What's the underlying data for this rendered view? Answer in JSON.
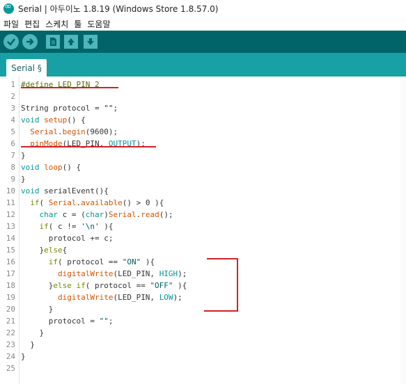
{
  "window": {
    "title": "Serial | 아두이노 1.8.19 (Windows Store 1.8.57.0)"
  },
  "menu": [
    "파일",
    "편집",
    "스케치",
    "툴",
    "도움말"
  ],
  "toolbar": {
    "buttons": [
      "verify-icon",
      "upload-icon",
      "new-icon",
      "open-icon",
      "save-icon"
    ]
  },
  "tabs": [
    {
      "label": "Serial §"
    }
  ],
  "colors": {
    "toolbar_bg": "#006468",
    "tabbar_bg": "#17a1a5",
    "button_fill": "#4db7bb",
    "annotation_red": "#d0202a"
  },
  "editor": {
    "lines": [
      {
        "n": "1",
        "tokens": [
          {
            "t": "#define LED_PIN 2",
            "c": "dir"
          }
        ]
      },
      {
        "n": "2",
        "tokens": []
      },
      {
        "n": "3",
        "tokens": [
          {
            "t": "String protocol = \"\";",
            "c": "plain"
          }
        ]
      },
      {
        "n": "4",
        "tokens": [
          {
            "t": "void",
            "c": "type"
          },
          {
            "t": " setup",
            "c": "func"
          },
          {
            "t": "() {",
            "c": "plain"
          }
        ]
      },
      {
        "n": "5",
        "tokens": [
          {
            "t": "  Serial",
            "c": "func"
          },
          {
            "t": ".",
            "c": "plain"
          },
          {
            "t": "begin",
            "c": "func"
          },
          {
            "t": "(9600);",
            "c": "plain"
          }
        ]
      },
      {
        "n": "6",
        "tokens": [
          {
            "t": "  pinMode",
            "c": "func"
          },
          {
            "t": "(LED_PIN, ",
            "c": "plain"
          },
          {
            "t": "OUTPUT",
            "c": "const"
          },
          {
            "t": ");",
            "c": "plain"
          }
        ]
      },
      {
        "n": "7",
        "tokens": [
          {
            "t": "}",
            "c": "plain"
          }
        ]
      },
      {
        "n": "8",
        "tokens": [
          {
            "t": "void",
            "c": "type"
          },
          {
            "t": " loop",
            "c": "func"
          },
          {
            "t": "() {",
            "c": "plain"
          }
        ]
      },
      {
        "n": "9",
        "tokens": [
          {
            "t": "}",
            "c": "plain"
          }
        ]
      },
      {
        "n": "10",
        "tokens": [
          {
            "t": "void",
            "c": "type"
          },
          {
            "t": " serialEvent",
            "c": "plain"
          },
          {
            "t": "(){",
            "c": "plain"
          }
        ]
      },
      {
        "n": "11",
        "tokens": [
          {
            "t": "  if",
            "c": "kw"
          },
          {
            "t": "( ",
            "c": "plain"
          },
          {
            "t": "Serial",
            "c": "func"
          },
          {
            "t": ".",
            "c": "plain"
          },
          {
            "t": "available",
            "c": "func"
          },
          {
            "t": "() > 0 ){",
            "c": "plain"
          }
        ]
      },
      {
        "n": "12",
        "tokens": [
          {
            "t": "    char",
            "c": "type"
          },
          {
            "t": " c = (",
            "c": "plain"
          },
          {
            "t": "char",
            "c": "type"
          },
          {
            "t": ")",
            "c": "plain"
          },
          {
            "t": "Serial",
            "c": "func"
          },
          {
            "t": ".",
            "c": "plain"
          },
          {
            "t": "read",
            "c": "func"
          },
          {
            "t": "();",
            "c": "plain"
          }
        ]
      },
      {
        "n": "13",
        "tokens": [
          {
            "t": "    if",
            "c": "kw"
          },
          {
            "t": "( c != ",
            "c": "plain"
          },
          {
            "t": "'\\n'",
            "c": "str"
          },
          {
            "t": " ){",
            "c": "plain"
          }
        ]
      },
      {
        "n": "14",
        "tokens": [
          {
            "t": "      protocol += c;",
            "c": "plain"
          }
        ]
      },
      {
        "n": "15",
        "tokens": [
          {
            "t": "    }",
            "c": "plain"
          },
          {
            "t": "else",
            "c": "kw"
          },
          {
            "t": "{",
            "c": "plain"
          }
        ]
      },
      {
        "n": "16",
        "tokens": [
          {
            "t": "      if",
            "c": "kw"
          },
          {
            "t": "( protocol == ",
            "c": "plain"
          },
          {
            "t": "\"ON\"",
            "c": "str"
          },
          {
            "t": " ){",
            "c": "plain"
          }
        ]
      },
      {
        "n": "17",
        "tokens": [
          {
            "t": "        digitalWrite",
            "c": "func"
          },
          {
            "t": "(LED_PIN, ",
            "c": "plain"
          },
          {
            "t": "HIGH",
            "c": "const"
          },
          {
            "t": ");",
            "c": "plain"
          }
        ]
      },
      {
        "n": "18",
        "tokens": [
          {
            "t": "      }",
            "c": "plain"
          },
          {
            "t": "else if",
            "c": "kw"
          },
          {
            "t": "( protocol == ",
            "c": "plain"
          },
          {
            "t": "\"OFF\"",
            "c": "str"
          },
          {
            "t": " ){",
            "c": "plain"
          }
        ]
      },
      {
        "n": "19",
        "tokens": [
          {
            "t": "        digitalWrite",
            "c": "func"
          },
          {
            "t": "(LED_PIN, ",
            "c": "plain"
          },
          {
            "t": "LOW",
            "c": "const"
          },
          {
            "t": ");",
            "c": "plain"
          }
        ]
      },
      {
        "n": "20",
        "tokens": [
          {
            "t": "      }",
            "c": "plain"
          }
        ]
      },
      {
        "n": "21",
        "tokens": [
          {
            "t": "      protocol = ",
            "c": "plain"
          },
          {
            "t": "\"\"",
            "c": "str"
          },
          {
            "t": ";",
            "c": "plain"
          }
        ]
      },
      {
        "n": "22",
        "tokens": [
          {
            "t": "    }",
            "c": "plain"
          }
        ]
      },
      {
        "n": "23",
        "tokens": [
          {
            "t": "  }",
            "c": "plain"
          }
        ]
      },
      {
        "n": "24",
        "tokens": [
          {
            "t": "}",
            "c": "plain"
          }
        ]
      },
      {
        "n": "25",
        "tokens": []
      }
    ]
  }
}
